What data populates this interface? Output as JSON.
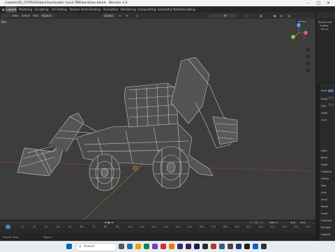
{
  "window": {
    "title": "...models\\05_CSTRUKS\\backhoe\\loader truck PBR\\backhoe.blend - Blender 4.0"
  },
  "menu": {
    "items": [
      "Layout",
      "Modeling",
      "Sculpting",
      "UV Editing",
      "Texture Paint",
      "Shading",
      "Animation",
      "Rendering",
      "Compositing",
      "Geometry Nodes",
      "Scripting"
    ],
    "active": "Layout"
  },
  "viewport_header": {
    "mode": "Object Mode",
    "view": "View",
    "select": "Select",
    "add": "Add",
    "object": "Object",
    "transform": "Global",
    "pivot": "Individual Origins",
    "options": "Options"
  },
  "viewport": {
    "left_text": "Bac",
    "gizmo_labels": [
      "X",
      "Y",
      "Z"
    ]
  },
  "outliner": {
    "items": [
      "Scene Coll",
      "Collect",
      "Backh"
    ]
  },
  "properties": {
    "labels": [
      "View",
      "Focal",
      "Clip",
      "Local",
      "Curs",
      "Light",
      "Rend",
      "Color",
      "Clipping",
      "Gizmo",
      "Tool",
      "Grid",
      "Scrol",
      "Panel",
      "Local",
      "Overlays",
      "Preview",
      "Inspect",
      "Conso",
      "Object",
      "Rotat",
      "Mode",
      "Scale"
    ]
  },
  "timeline": {
    "ticks": [
      "0",
      "10",
      "20",
      "30",
      "40",
      "50",
      "60",
      "70",
      "80",
      "90",
      "100",
      "110",
      "120",
      "130",
      "140",
      "150",
      "160",
      "170",
      "180",
      "190",
      "200",
      "210",
      "220",
      "230",
      "240",
      "250"
    ],
    "current_frame": "1",
    "start_label": "Start",
    "start": "1",
    "end_label": "End",
    "end": "250"
  },
  "statusbar": {
    "left": "Rotate View",
    "right": "Object"
  },
  "taskbar": {
    "search": "Search"
  },
  "colors": {
    "accent": "#4a6fa5",
    "axis_x": "#d0444f",
    "axis_y": "#85b82b",
    "axis_z": "#3b7fe0"
  }
}
